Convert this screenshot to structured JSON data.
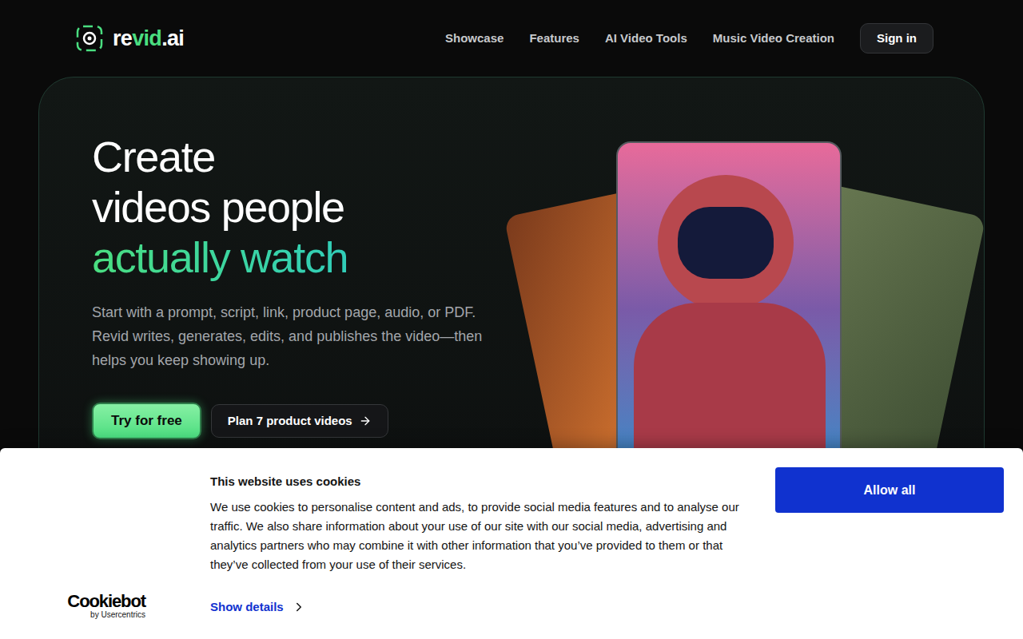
{
  "header": {
    "logo": [
      {
        "text": "re",
        "color": "#ffffff"
      },
      {
        "text": "vid",
        "color": "#4ade80"
      },
      {
        "text": ".ai",
        "color": "#ffffff"
      }
    ],
    "nav": [
      {
        "label": "Showcase"
      },
      {
        "label": "Features"
      },
      {
        "label": "AI Video Tools"
      },
      {
        "label": "Music Video Creation"
      }
    ],
    "sign_in": "Sign in"
  },
  "hero": {
    "title_lines": [
      "Create",
      "videos people"
    ],
    "title_highlight": "actually watch",
    "description": "Start with a prompt, script, link, product page, audio, or PDF. Revid writes, generates, edits, and publishes the video—then helps you keep showing up.",
    "primary_button": "Try for free",
    "secondary_button": "Plan 7 product videos"
  },
  "cookie_banner": {
    "title": "This website uses cookies",
    "body": "We use cookies to personalise content and ads, to provide social media features and to analyse our traffic. We also share information about your use of our site with our social media, advertising and analytics partners who may combine it with other information that you’ve provided to them or that they’ve collected from your use of their services.",
    "allow_button": "Allow all",
    "details_link": "Show details",
    "brand": "Cookiebot",
    "brand_sub": "by Usercentrics"
  }
}
